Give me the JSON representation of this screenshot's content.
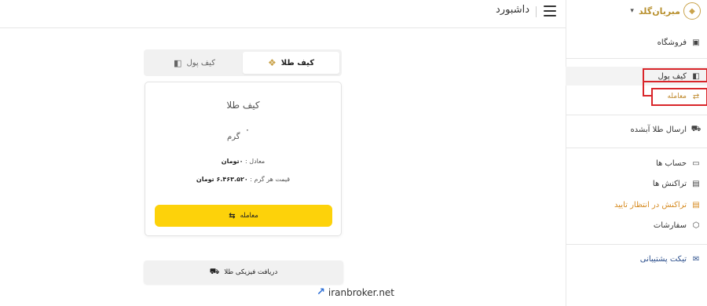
{
  "brand": {
    "name": "مبریان‌گلد"
  },
  "header": {
    "title": "داشبورد"
  },
  "sidebar": {
    "items": [
      {
        "label": "فروشگاه"
      },
      {
        "label": "کیف پول"
      },
      {
        "label": "معامله"
      },
      {
        "label": "ارسال طلا آبشده"
      },
      {
        "label": "حساب ها"
      },
      {
        "label": "تراکنش ها"
      },
      {
        "label": "تراکنش در انتظار تایید"
      },
      {
        "label": "سفارشات"
      },
      {
        "label": "تیکت پشتیبانی"
      }
    ]
  },
  "tabs": [
    {
      "label": "کیف طلا"
    },
    {
      "label": "کیف پول"
    }
  ],
  "card": {
    "title": "کیف طلا",
    "amount": "۰",
    "unit": "گرم",
    "equiv_label": "معادل :",
    "equiv_value": "۰تومان",
    "price_label": "قیمت هر گرم :",
    "price_value": "۶.۴۶۳.۵۲۰ تومان",
    "trade_label": "معامله"
  },
  "receipt": {
    "label": "دریافت فیزیکی طلا"
  },
  "watermark": {
    "text": "iranbroker.net"
  },
  "colors": {
    "accent": "#fdd20a",
    "gold": "#c9a24a",
    "highlight": "#d9252a",
    "pending": "#d68a1f"
  }
}
